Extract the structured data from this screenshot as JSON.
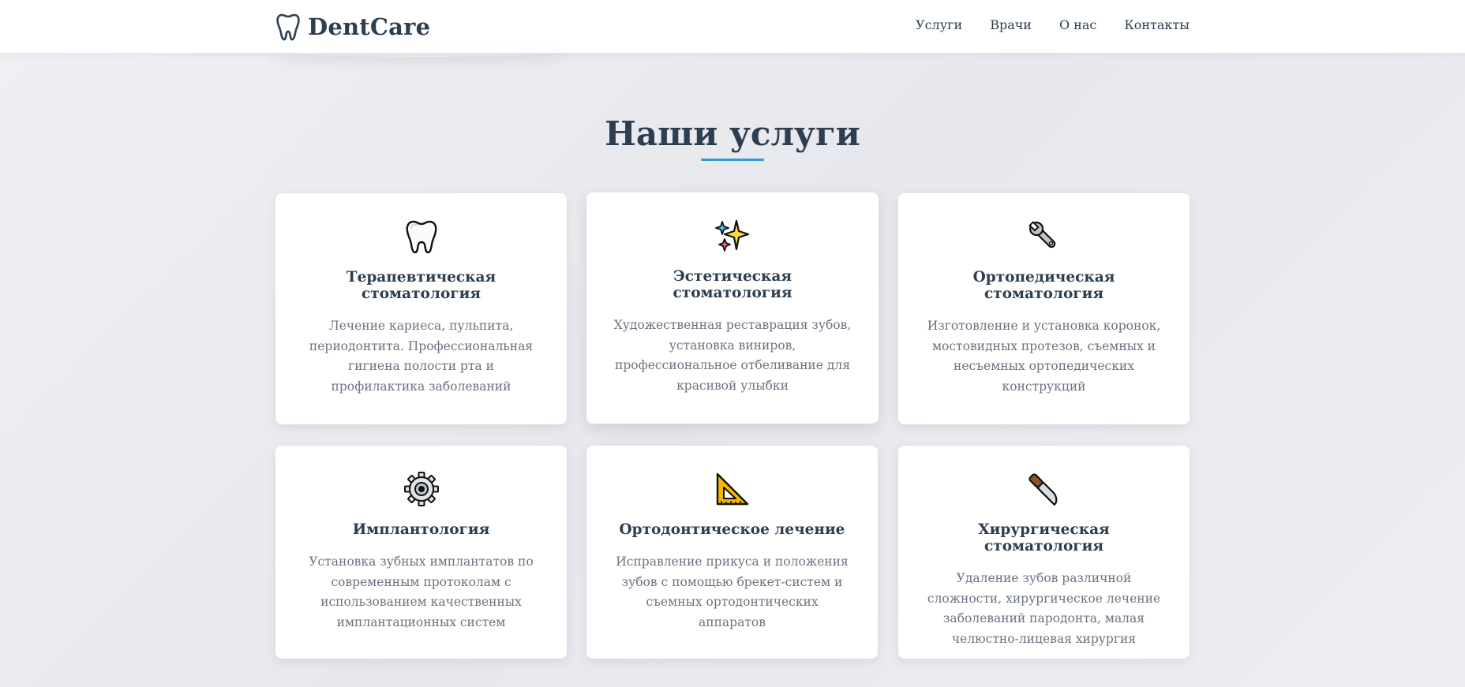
{
  "brand": {
    "name": "DentCare"
  },
  "nav": [
    {
      "label": "Услуги"
    },
    {
      "label": "Врачи"
    },
    {
      "label": "О нас"
    },
    {
      "label": "Контакты"
    }
  ],
  "services": {
    "title": "Наши услуги",
    "cards": [
      {
        "icon": "tooth-icon",
        "title": "Терапевтическая стоматология",
        "text": "Лечение кариеса, пульпита, периодонтита. Профессиональная гигиена полости рта и профилактика заболеваний"
      },
      {
        "icon": "sparkles-icon",
        "title": "Эстетическая стоматология",
        "text": "Художественная реставрация зубов, установка виниров, профессиональное отбеливание для красивой улыбки"
      },
      {
        "icon": "wrench-icon",
        "title": "Ортопедическая стоматология",
        "text": "Изготовление и установка коронок, мостовидных протезов, съемных и несъемных ортопедических конструкций"
      },
      {
        "icon": "gear-icon",
        "title": "Имплантология",
        "text": "Установка зубных имплантатов по современным протоколам с использованием качественных имплантационных систем"
      },
      {
        "icon": "triangular-ruler-icon",
        "title": "Ортодонтическое лечение",
        "text": "Исправление прикуса и положения зубов с помощью брекет-систем и съемных ортодонтических аппаратов"
      },
      {
        "icon": "knife-icon",
        "title": "Хирургическая стоматология",
        "text": "Удаление зубов различной сложности, хирургическое лечение заболеваний пародонта, малая челюстно-лицевая хирургия"
      }
    ]
  },
  "colors": {
    "accent": "#3498db",
    "heading": "#2c3e50",
    "body_text": "#6b7280"
  }
}
